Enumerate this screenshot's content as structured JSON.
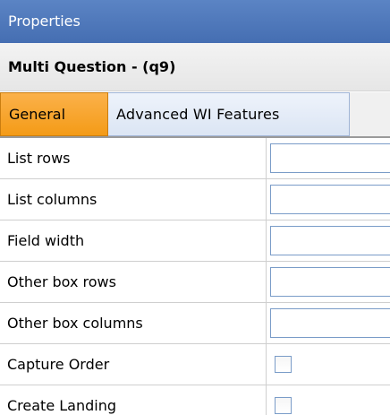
{
  "panel": {
    "title": "Properties",
    "subtitle": "Multi Question - (q9)"
  },
  "tabs": [
    {
      "label": "General",
      "active": true
    },
    {
      "label": "Advanced WI Features",
      "active": false
    }
  ],
  "rows": [
    {
      "label": "List rows",
      "type": "text",
      "value": ""
    },
    {
      "label": "List columns",
      "type": "text",
      "value": ""
    },
    {
      "label": "Field width",
      "type": "text",
      "value": ""
    },
    {
      "label": "Other box rows",
      "type": "text",
      "value": ""
    },
    {
      "label": "Other box columns",
      "type": "text",
      "value": ""
    },
    {
      "label": "Capture Order",
      "type": "checkbox",
      "checked": false
    },
    {
      "label": "Create Landing",
      "type": "checkbox",
      "checked": false
    }
  ],
  "colors": {
    "title_bg": "#456eb2",
    "active_tab": "#f49b17",
    "inactive_tab": "#dbe5f4",
    "input_border": "#7a9cc8"
  }
}
